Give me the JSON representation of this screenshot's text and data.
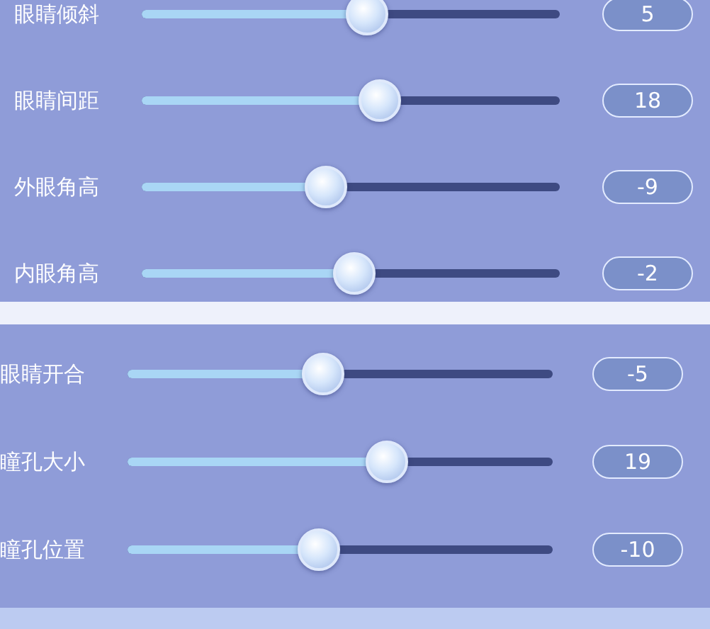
{
  "panels": [
    {
      "sliders": [
        {
          "label": "眼睛倾斜",
          "level": 0.54,
          "value": "5"
        },
        {
          "label": "眼睛间距",
          "level": 0.57,
          "value": "18"
        },
        {
          "label": "外眼角高",
          "level": 0.44,
          "value": "-9"
        },
        {
          "label": "内眼角高",
          "level": 0.51,
          "value": "-2"
        }
      ]
    },
    {
      "sliders": [
        {
          "label": "眼睛开合",
          "level": 0.46,
          "value": "-5"
        },
        {
          "label": "瞳孔大小",
          "level": 0.61,
          "value": "19"
        },
        {
          "label": "瞳孔位置",
          "level": 0.45,
          "value": "-10"
        }
      ]
    }
  ]
}
